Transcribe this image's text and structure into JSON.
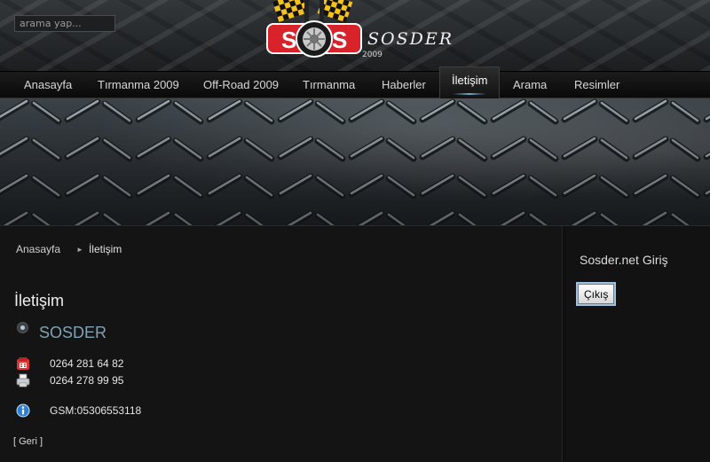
{
  "header": {
    "search_placeholder": "arama yap...",
    "logo_text": "S.O.S",
    "site_title": "SOSDER",
    "year": "2009"
  },
  "nav": {
    "items": [
      {
        "label": "Anasayfa"
      },
      {
        "label": "Tırmanma 2009"
      },
      {
        "label": "Off-Road 2009"
      },
      {
        "label": "Tırmanma"
      },
      {
        "label": "Haberler"
      },
      {
        "label": "İletişim",
        "active": true
      },
      {
        "label": "Arama"
      },
      {
        "label": "Resimler"
      }
    ]
  },
  "breadcrumb": {
    "home": "Anasayfa",
    "current": "İletişim"
  },
  "page": {
    "title": "İletişim",
    "contact_name": "SOSDER",
    "phone": "0264 281 64 82",
    "fax": "0264 278 99 95",
    "gsm": "GSM:05306553118",
    "back_link": "[ Geri ]"
  },
  "sidebar": {
    "title": "Sosder.net Giriş",
    "logout_label": "Çıkış"
  },
  "icons": {
    "phone": "phone-icon",
    "fax": "fax-icon",
    "info": "info-icon"
  },
  "colors": {
    "background": "#131313",
    "accent": "#7fa3b6",
    "logo_red": "#d8232a"
  }
}
